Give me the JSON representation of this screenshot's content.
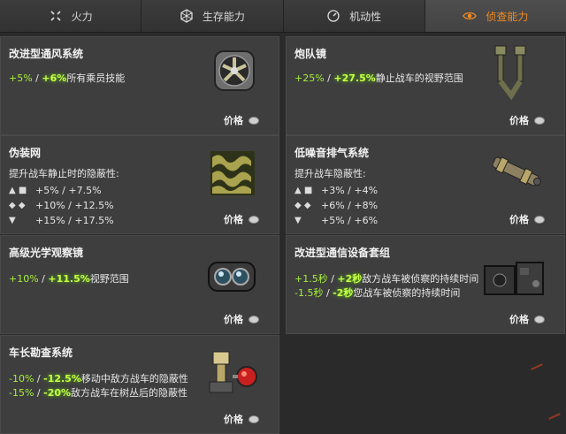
{
  "tabs": [
    {
      "label": "火力",
      "icon": "crosshair-icon"
    },
    {
      "label": "生存能力",
      "icon": "armor-icon"
    },
    {
      "label": "机动性",
      "icon": "speedometer-icon"
    },
    {
      "label": "侦查能力",
      "icon": "eye-icon",
      "active": true
    }
  ],
  "price_label": "价格",
  "cards": {
    "vent": {
      "title": "改进型通风系统",
      "l1a": "+5%",
      "sep": " / ",
      "l1b": "+6%",
      "l1t": "所有乘员技能"
    },
    "binoc": {
      "title": "炮队镜",
      "l1a": "+25%",
      "sep": " / ",
      "l1b": "+27.5%",
      "l1t": "静止战车的视野范围"
    },
    "camo": {
      "title": "伪装网",
      "desc": "提升战车静止时的隐蔽性:",
      "rows": [
        {
          "icon": "▲ ■",
          "a": "+5%",
          "b": "+7.5%"
        },
        {
          "icon": "◆ ◆",
          "a": "+10%",
          "b": "+12.5%"
        },
        {
          "icon": "▼",
          "a": "+15%",
          "b": "+17.5%"
        }
      ]
    },
    "exhaust": {
      "title": "低噪音排气系统",
      "desc": "提升战车隐蔽性:",
      "rows": [
        {
          "icon": "▲ ■",
          "a": "+3%",
          "b": "+4%"
        },
        {
          "icon": "◆ ◆",
          "a": "+6%",
          "b": "+8%"
        },
        {
          "icon": "▼",
          "a": "+5%",
          "b": "+6%"
        }
      ]
    },
    "optics": {
      "title": "高级光学观察镜",
      "l1a": "+10%",
      "sep": " / ",
      "l1b": "+11.5%",
      "l1t": "视野范围"
    },
    "radio": {
      "title": "改进型通信设备套组",
      "l1a": "+1.5秒",
      "sep": " / ",
      "l1b": "+2秒",
      "l1t": "敌方战车被侦察的持续时间",
      "l2a": "-1.5秒",
      "l2b": "-2秒",
      "l2t": "您战车被侦察的持续时间"
    },
    "recon": {
      "title": "车长勘查系统",
      "l1a": "-10%",
      "sep": " / ",
      "l1b": "-12.5%",
      "l1t": "移动中敌方战车的隐蔽性",
      "l2a": "-15%",
      "l2b": "-20%",
      "l2t": "敌方战车在树丛后的隐蔽性"
    }
  }
}
